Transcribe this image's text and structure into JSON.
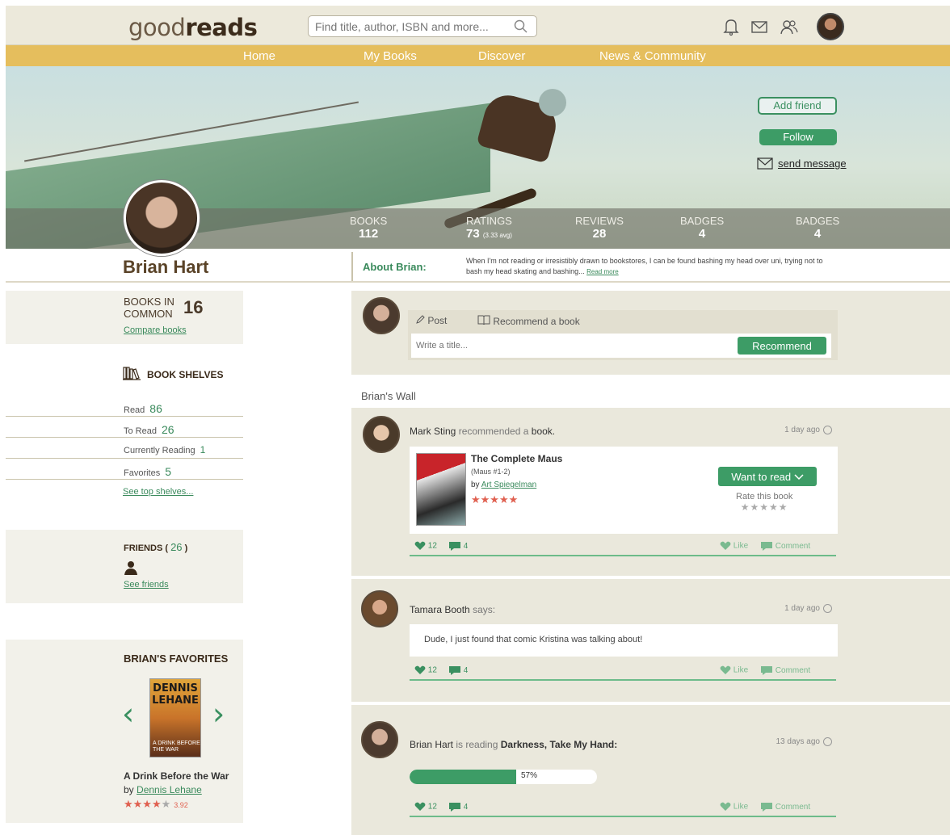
{
  "header": {
    "logo_light": "good",
    "logo_bold": "reads",
    "search_placeholder": "Find title, author, ISBN and more...",
    "icons": [
      "bell-icon",
      "mail-icon",
      "friends-icon",
      "search-icon"
    ]
  },
  "nav": [
    "Home",
    "My Books",
    "Discover",
    "News & Community"
  ],
  "profile": {
    "name": "Brian Hart",
    "add_friend": "Add friend",
    "follow": "Follow",
    "send_message": "send message",
    "stats": [
      {
        "label": "BOOKS",
        "value": "112",
        "sub": ""
      },
      {
        "label": "RATINGS",
        "value": "73",
        "sub": "(3.33 avg)"
      },
      {
        "label": "REVIEWS",
        "value": "28",
        "sub": ""
      },
      {
        "label": "BADGES",
        "value": "4",
        "sub": ""
      },
      {
        "label": "BADGES",
        "value": "4",
        "sub": ""
      }
    ],
    "about_label": "About Brian:",
    "about_text": "When I'm not reading or irresistibly drawn to bookstores, I can be found bashing my head over uni, trying not to bash my head skating and bashing...",
    "read_more": "Read more"
  },
  "sidebar": {
    "books_in_common_l1": "BOOKS IN",
    "books_in_common_l2": "COMMON",
    "books_in_common_count": "16",
    "compare_books": "Compare books",
    "shelves_title": "BOOK SHELVES",
    "shelves": [
      {
        "label": "Read",
        "count": "86"
      },
      {
        "label": "To Read",
        "count": "26"
      },
      {
        "label": "Currently Reading",
        "count": "1"
      },
      {
        "label": "Favorites",
        "count": "5"
      }
    ],
    "see_top_shelves": "See top shelves...",
    "friends_label": "FRIENDS (",
    "friends_count": "26",
    "friends_close": ")",
    "see_friends": "See friends",
    "favorites_title": "BRIAN'S FAVORITES",
    "fav_cover_author": "DENNIS LEHANE",
    "fav_cover_title": "A DRINK BEFORE THE WAR",
    "fav_title": "A Drink Before the War",
    "fav_by": "by",
    "fav_author": "Dennis Lehane",
    "fav_stars_filled": "★★★★",
    "fav_stars_empty": "★",
    "fav_rating": "3.92",
    "fav_rating_value": 3.92
  },
  "composer": {
    "post_tab": "Post",
    "recommend_tab": "Recommend a book",
    "title_placeholder": "Write a title...",
    "recommend_btn": "Recommend"
  },
  "wall": {
    "title": "Brian's Wall",
    "posts": [
      {
        "author": "Mark Sting",
        "verb": "recommended a",
        "object": "book.",
        "time": "1 day ago",
        "book_title": "The Complete Maus",
        "book_series": "(Maus #1-2)",
        "book_by": "by",
        "book_author": "Art Spiegelman",
        "book_stars": "★★★★★",
        "want_to_read": "Want to read",
        "rate_label": "Rate this book",
        "rate_stars": "★★★★★",
        "likes": "12",
        "comments": "4",
        "like_label": "Like",
        "comment_label": "Comment"
      },
      {
        "author": "Tamara Booth",
        "verb": "says:",
        "time": "1 day ago",
        "message": "Dude, I just found that comic Kristina was talking about!",
        "likes": "12",
        "comments": "4",
        "like_label": "Like",
        "comment_label": "Comment"
      },
      {
        "author": "Brian Hart",
        "verb": "is reading",
        "object": "Darkness, Take My Hand:",
        "time": "13 days ago",
        "progress_label": "57%",
        "progress_value": 57,
        "likes": "12",
        "comments": "4",
        "like_label": "Like",
        "comment_label": "Comment"
      }
    ]
  },
  "colors": {
    "accent_green": "#3d9c66",
    "nav_gold": "#e5be5d",
    "star_red": "#e06050"
  }
}
